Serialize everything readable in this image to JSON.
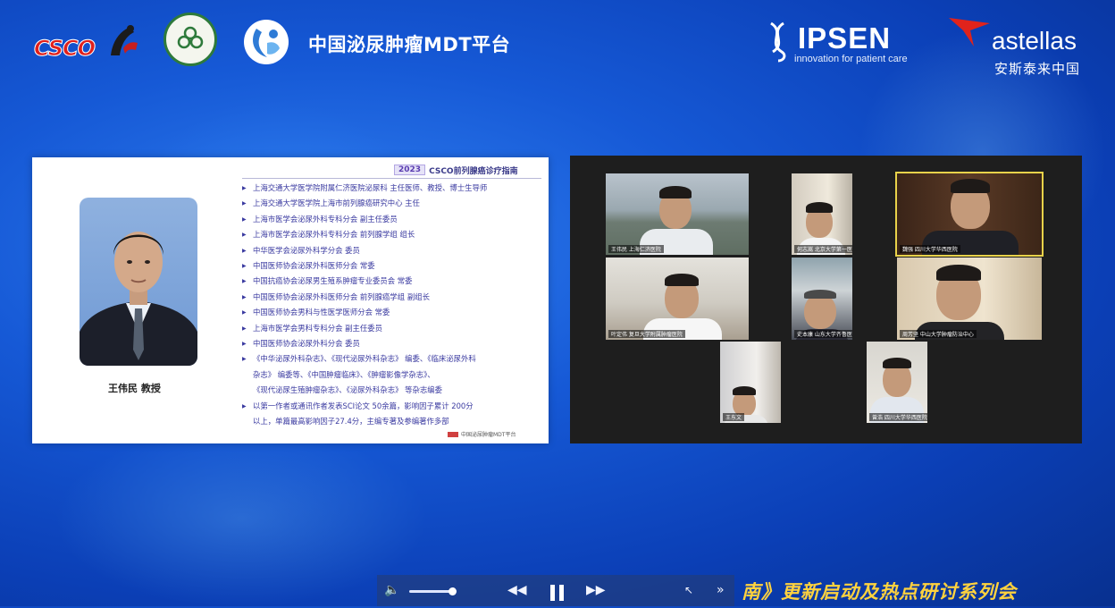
{
  "header": {
    "csco_logo": "CSCO",
    "mdt_platform": "中国泌尿肿瘤MDT平台",
    "ipsen_logo": "IPSEN",
    "ipsen_tagline": "innovation for patient care",
    "astellas_logo": "astellas",
    "astellas_cn": "安斯泰来中国"
  },
  "slide": {
    "tag_year": "2023",
    "tag_text": "CSCO前列腺癌诊疗指南",
    "speaker_name": "王伟民  教授",
    "bio": [
      {
        "text": "上海交通大学医学院附属仁济医院泌尿科 主任医师、教授、博士生导师",
        "bullet": true
      },
      {
        "text": "上海交通大学医学院上海市前列腺癌研究中心 主任",
        "bullet": true
      },
      {
        "text": "上海市医学会泌尿外科专科分会 副主任委员",
        "bullet": true
      },
      {
        "text": "上海市医学会泌尿外科专科分会 前列腺学组 组长",
        "bullet": true
      },
      {
        "text": "中华医学会泌尿外科学分会 委员",
        "bullet": true
      },
      {
        "text": "中国医师协会泌尿外科医师分会 常委",
        "bullet": true
      },
      {
        "text": "中国抗癌协会泌尿男生殖系肿瘤专业委员会 常委",
        "bullet": true
      },
      {
        "text": "中国医师协会泌尿外科医师分会 前列腺癌学组 副组长",
        "bullet": true
      },
      {
        "text": "中国医师协会男科与性医学医师分会 常委",
        "bullet": true
      },
      {
        "text": "上海市医学会男科专科分会 副主任委员",
        "bullet": true
      },
      {
        "text": "中国医师协会泌尿外科分会 委员",
        "bullet": true
      },
      {
        "text": "《中华泌尿外科杂志》、《现代泌尿外科杂志》 编委、《临床泌尿外科",
        "bullet": true
      },
      {
        "text": "杂志》 编委等、《中国肿瘤临床》、《肿瘤影像学杂志》、",
        "bullet": false
      },
      {
        "text": "《现代泌尿生殖肿瘤杂志》、《泌尿外科杂志》 等杂志编委",
        "bullet": false
      },
      {
        "text": "以第一作者或通讯作者发表SCI论文 50余篇，影响因子累计 200分",
        "bullet": true
      },
      {
        "text": "以上，单篇最高影响因子27.4分，主编专著及参编著作多部",
        "bullet": false
      }
    ],
    "footer": "中国泌尿肿瘤MDT平台"
  },
  "video": {
    "participants": [
      {
        "label": "王伟民 上海仁济医院"
      },
      {
        "label": "何志嵩 北京大学第一医院"
      },
      {
        "label": "魏强 四川大学华西医院"
      },
      {
        "label": "叶定伟 复旦大学附属肿瘤医院"
      },
      {
        "label": "史本康 山东大学齐鲁医院"
      },
      {
        "label": "周芳坚 中山大学肿瘤防治中心"
      },
      {
        "label": "王东文"
      },
      {
        "label": "曾浩 四川大学华西医院"
      }
    ]
  },
  "player": {
    "volume_icon": "speaker-icon",
    "progress": 0.85,
    "banner": "南》更新启动及热点研讨系列会"
  }
}
